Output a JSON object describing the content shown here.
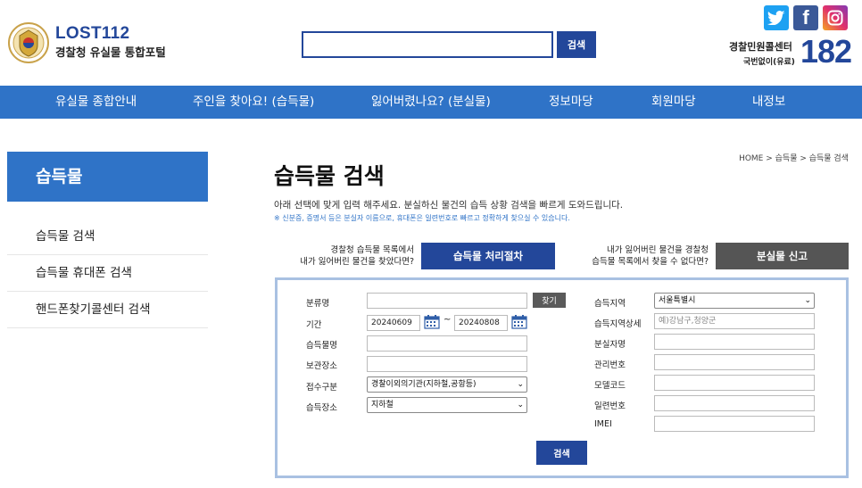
{
  "header": {
    "logo_title": "LOST112",
    "logo_sub": "경찰청 유실물 통합포털",
    "search_value": "",
    "search_button": "검색",
    "callcenter_label": "경찰민원콜센터",
    "callcenter_sub": "국번없이(유료)",
    "callcenter_number": "182",
    "sns": {
      "twitter": "twitter-icon",
      "facebook": "facebook-icon",
      "instagram": "instagram-icon"
    },
    "facebook_glyph": "f"
  },
  "nav": {
    "items": [
      "유실물 종합안내",
      "주인을 찾아요! (습득물)",
      "잃어버렸나요? (분실물)",
      "정보마당",
      "회원마당",
      "내정보"
    ]
  },
  "sidebar": {
    "title": "습득물",
    "items": [
      "습득물 검색",
      "습득물 휴대폰 검색",
      "핸드폰찾기콜센터 검색"
    ]
  },
  "main": {
    "breadcrumb": "HOME > 습득물 > 습득물 검색",
    "title": "습득물 검색",
    "description": "아래 선택에 맞게 입력 해주세요. 분실하신 물건의 습득 상황 검색을 빠르게 도와드립니다.",
    "note": "※ 신분증, 증명서 등은 분실자 이름으로, 휴대폰은 일련번호로 빠르고 정확하게 찾으실 수 있습니다."
  },
  "promo": {
    "left_line1": "경찰청 습득물 목록에서",
    "left_line2": "내가 잃어버린 물건을 찾았다면?",
    "left_button": "습득물 처리절차",
    "right_line1": "내가 잃어버린 물건을 경찰청",
    "right_line2": "습득물 목록에서 찾을 수 없다면?",
    "right_button": "분실물 신고"
  },
  "form": {
    "labels": {
      "category": "분류명",
      "period": "기간",
      "item_name": "습득물명",
      "storage": "보관장소",
      "receipt_type": "접수구분",
      "found_place": "습득장소",
      "region": "습득지역",
      "region_detail": "습득지역상세",
      "owner_name": "분실자명",
      "manage_no": "관리번호",
      "model_code": "모델코드",
      "serial_no": "일련번호",
      "imei": "IMEI"
    },
    "find_button": "찾기",
    "date_from": "20240609",
    "date_to": "20240808",
    "date_sep": "~",
    "receipt_type_value": "경찰이외의기관(지하철,공항등)",
    "found_place_value": "지하철",
    "region_value": "서울특별시",
    "region_detail_placeholder": "예)강남구,청양군",
    "submit_button": "검색"
  },
  "colors": {
    "brand": "#23479a",
    "nav": "#2f73c7",
    "form_border": "#a9c1e2"
  }
}
